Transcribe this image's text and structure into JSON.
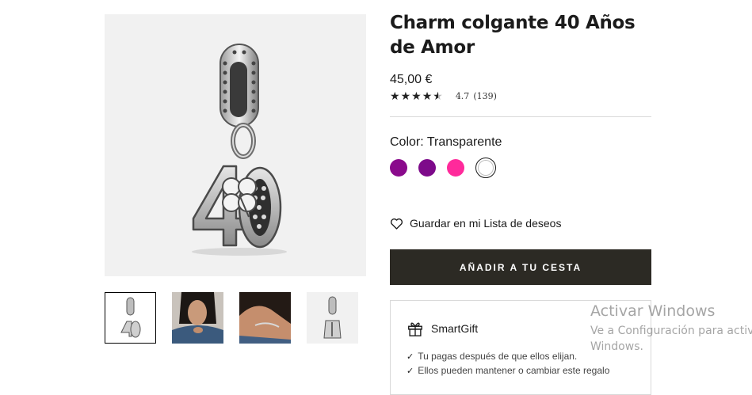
{
  "product": {
    "title": "Charm colgante 40 Años de Amor",
    "price": "45,00 €",
    "rating": "4.7",
    "review_count": "(139)",
    "stars": 4.7
  },
  "color": {
    "label": "Color:",
    "selected": "Transparente",
    "swatches": [
      {
        "name": "violet",
        "hex": "#8a0a8c"
      },
      {
        "name": "purple",
        "hex": "#7d0a8a"
      },
      {
        "name": "pink",
        "hex": "#ff2a9b"
      },
      {
        "name": "transparent",
        "hex": "#ffffff"
      }
    ]
  },
  "wishlist": {
    "label": "Guardar en mi Lista de deseos"
  },
  "cart": {
    "button_label": "AÑADIR A TU CESTA"
  },
  "smartgift": {
    "title": "SmartGift",
    "lines": [
      "Tu pagas después de que ellos elijan.",
      "Ellos pueden mantener o cambiar este regalo"
    ]
  },
  "gallery": {
    "thumbnails": [
      "charm-front",
      "model-face",
      "model-wrist",
      "charm-side"
    ]
  },
  "os_watermark": {
    "title": "Activar Windows",
    "line1": "Ve a Configuración para activar",
    "line2": "Windows."
  }
}
